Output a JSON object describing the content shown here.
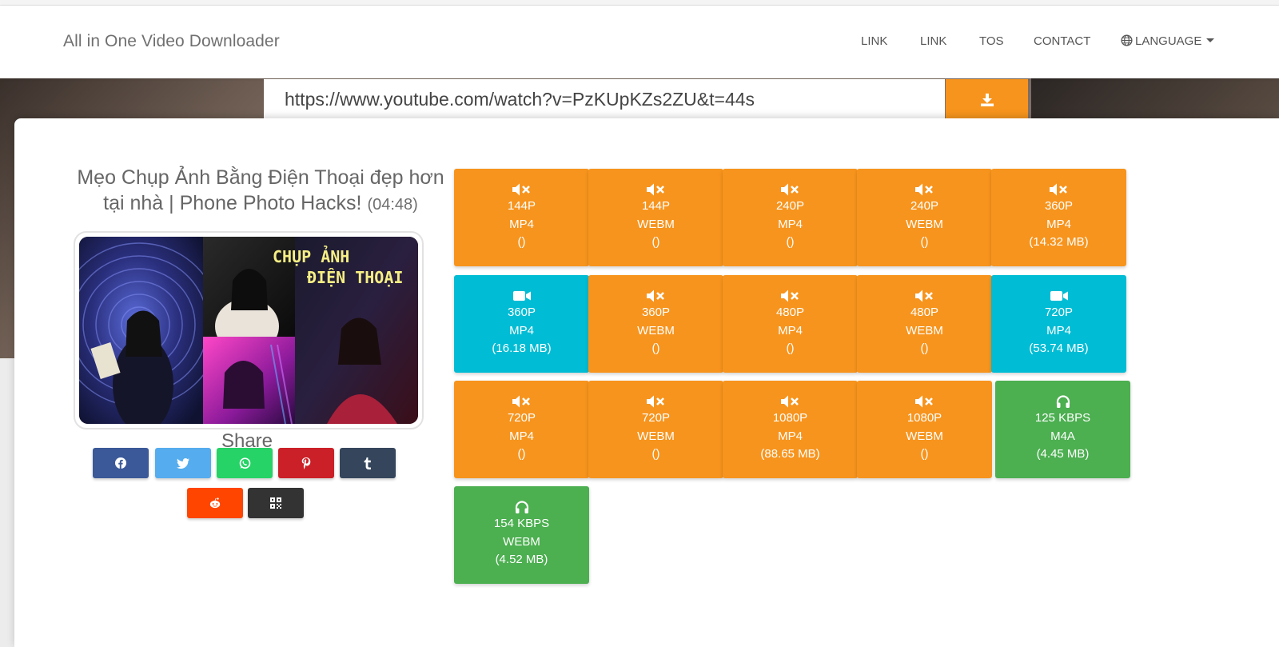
{
  "brand": "All in One Video Downloader",
  "nav": {
    "link1": "LINK",
    "link2": "LINK",
    "tos": "TOS",
    "contact": "CONTACT",
    "language": "LANGUAGE"
  },
  "search": {
    "url": "https://www.youtube.com/watch?v=PzKUpKZs2ZU&t=44s"
  },
  "video": {
    "title": "Mẹo Chụp Ảnh Bằng Điện Thoại đẹp hơn tại nhà | Phone Photo Hacks!",
    "duration": "(04:48)",
    "thumbnail_text_line1": "CHỤP ẢNH",
    "thumbnail_text_line2": "ĐIỆN THOẠI"
  },
  "share": {
    "label": "Share",
    "buttons": [
      {
        "name": "facebook",
        "color": "#3b5998"
      },
      {
        "name": "twitter",
        "color": "#55acee"
      },
      {
        "name": "whatsapp",
        "color": "#25d366"
      },
      {
        "name": "pinterest",
        "color": "#cb2027"
      },
      {
        "name": "tumblr",
        "color": "#35465c"
      },
      {
        "name": "reddit",
        "color": "#ff4500"
      },
      {
        "name": "qrcode",
        "color": "#333333"
      }
    ]
  },
  "colors": {
    "no_audio": "#f7941d",
    "video": "#00bcd4",
    "audio": "#4caf50"
  },
  "downloads": [
    {
      "quality": "144P",
      "format": "MP4",
      "size": "()",
      "kind": "no-audio",
      "icon": "mute-icon"
    },
    {
      "quality": "144P",
      "format": "WEBM",
      "size": "()",
      "kind": "no-audio",
      "icon": "mute-icon"
    },
    {
      "quality": "240P",
      "format": "MP4",
      "size": "()",
      "kind": "no-audio",
      "icon": "mute-icon"
    },
    {
      "quality": "240P",
      "format": "WEBM",
      "size": "()",
      "kind": "no-audio",
      "icon": "mute-icon"
    },
    {
      "quality": "360P",
      "format": "MP4",
      "size": "(14.32 MB)",
      "kind": "no-audio",
      "icon": "mute-icon"
    },
    {
      "quality": "360P",
      "format": "MP4",
      "size": "(16.18 MB)",
      "kind": "video",
      "icon": "video-camera-icon"
    },
    {
      "quality": "360P",
      "format": "WEBM",
      "size": "()",
      "kind": "no-audio",
      "icon": "mute-icon"
    },
    {
      "quality": "480P",
      "format": "MP4",
      "size": "()",
      "kind": "no-audio",
      "icon": "mute-icon"
    },
    {
      "quality": "480P",
      "format": "WEBM",
      "size": "()",
      "kind": "no-audio",
      "icon": "mute-icon"
    },
    {
      "quality": "720P",
      "format": "MP4",
      "size": "(53.74 MB)",
      "kind": "video",
      "icon": "video-camera-icon"
    },
    {
      "quality": "720P",
      "format": "MP4",
      "size": "()",
      "kind": "no-audio",
      "icon": "mute-icon"
    },
    {
      "quality": "720P",
      "format": "WEBM",
      "size": "()",
      "kind": "no-audio",
      "icon": "mute-icon"
    },
    {
      "quality": "1080P",
      "format": "MP4",
      "size": "(88.65 MB)",
      "kind": "no-audio",
      "icon": "mute-icon"
    },
    {
      "quality": "1080P",
      "format": "WEBM",
      "size": "()",
      "kind": "no-audio",
      "icon": "mute-icon"
    },
    {
      "quality": "125 KBPS",
      "format": "M4A",
      "size": "(4.45 MB)",
      "kind": "audio",
      "icon": "headphones-icon"
    },
    {
      "quality": "154 KBPS",
      "format": "WEBM",
      "size": "(4.52 MB)",
      "kind": "audio",
      "icon": "headphones-icon"
    }
  ]
}
